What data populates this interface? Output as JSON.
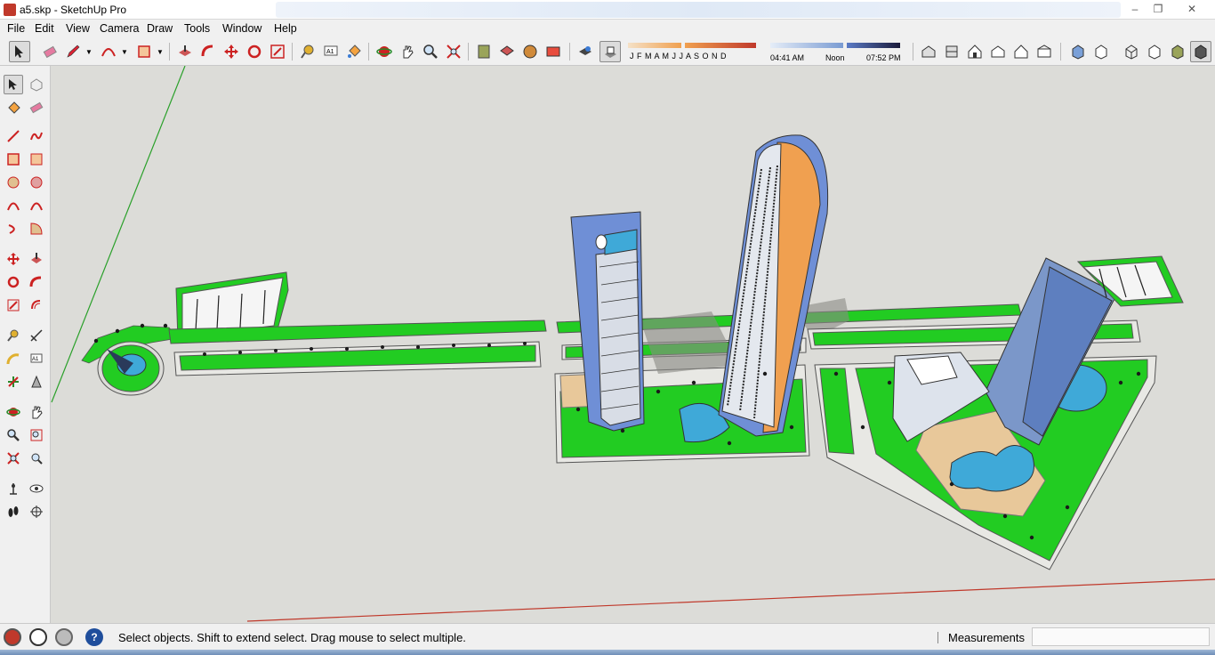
{
  "window": {
    "title": "a5.skp - SketchUp Pro",
    "controls": [
      "minimize",
      "restore",
      "close"
    ]
  },
  "menu": [
    "File",
    "Edit",
    "View",
    "Camera",
    "Draw",
    "Tools",
    "Window",
    "Help"
  ],
  "toolbar": {
    "shadow_months": "J  F  M  A  M  J  J  A  S  O  N  D",
    "time_start": "04:41 AM",
    "time_mid": "Noon",
    "time_end": "07:52 PM",
    "tools": [
      "select-tool",
      "eraser-tool",
      "pencil-tool",
      "arc-tool",
      "rectangle-tool",
      "push-pull-tool",
      "follow-me-tool",
      "move-tool",
      "rotate-tool",
      "scale-tool",
      "tape-measure-tool",
      "text-tool",
      "paint-bucket-tool",
      "orbit-tool",
      "pan-tool",
      "zoom-tool",
      "zoom-extents-tool",
      "components-tool",
      "warehouse-tool",
      "share-model-tool",
      "layers-tool",
      "shadow-settings-tool",
      "shadows-toggle",
      "iso-view",
      "top-view",
      "front-view",
      "right-view",
      "back-view",
      "left-view",
      "xray-style",
      "wireframe-style",
      "hidden-line-style",
      "shaded-style",
      "shaded-texture-style",
      "monochrome-style"
    ]
  },
  "status": {
    "hint": "Select objects. Shift to extend select. Drag mouse to select multiple.",
    "measurements_label": "Measurements",
    "measurements_value": ""
  },
  "colors": {
    "viewport_bg": "#dcdcd8",
    "grass": "#22cc22",
    "tower_blue": "#6f8fd6",
    "tower_orange": "#f0a050",
    "water": "#3fa9d8",
    "plaza": "#e8c89a",
    "axis_green": "#2aa02a",
    "axis_red": "#c0392b"
  }
}
